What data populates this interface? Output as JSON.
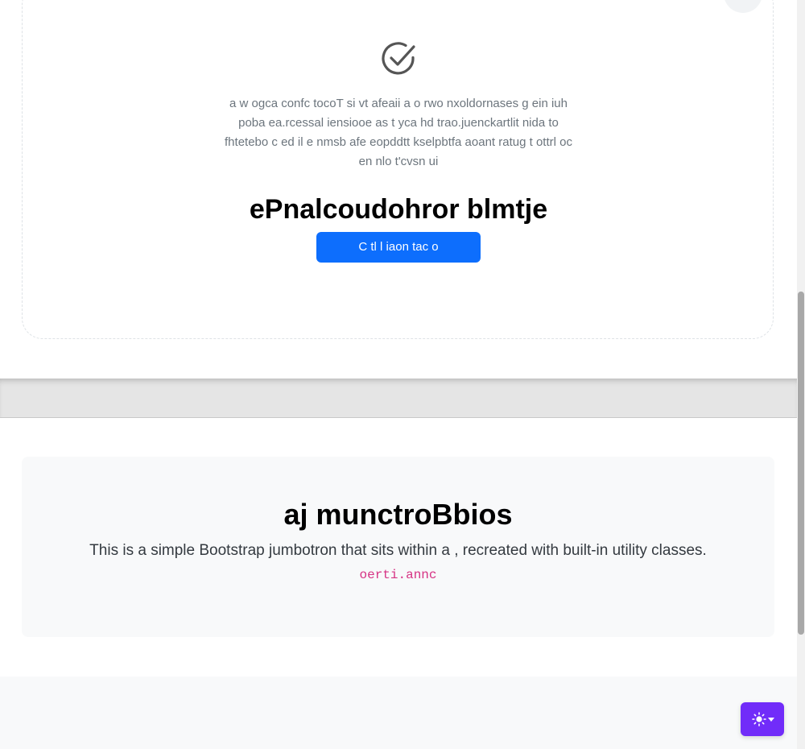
{
  "card": {
    "icon": "check-circle-icon",
    "text": "a w ogca confc tocoT si vt afeaii a o rwo nxoldornases g ein iuh poba ea.rcessal iensiooe as t yca hd trao.juenckartlit nida to fhtetebo c ed il e nmsb afe eopddtt kselpbtfa aoant ratug t ottrl oc en nlo t'cvsn ui",
    "heading": "ePnalcoudohror blmtje",
    "button_label": "C tl l iaon tac o"
  },
  "jumbotron": {
    "title": "aj munctroBbios",
    "lead": "This is a simple Bootstrap jumbotron that sits within a , recreated with built-in utility classes.",
    "code": "oerti.annc"
  },
  "theme_toggle": {
    "icon": "sun-icon",
    "caret_icon": "caret-down-icon",
    "accent_color": "#712cf9"
  },
  "colors": {
    "primary_button": "#0d6efd",
    "code_text": "#d63384",
    "jumbotron_bg": "#f8f9fa"
  }
}
